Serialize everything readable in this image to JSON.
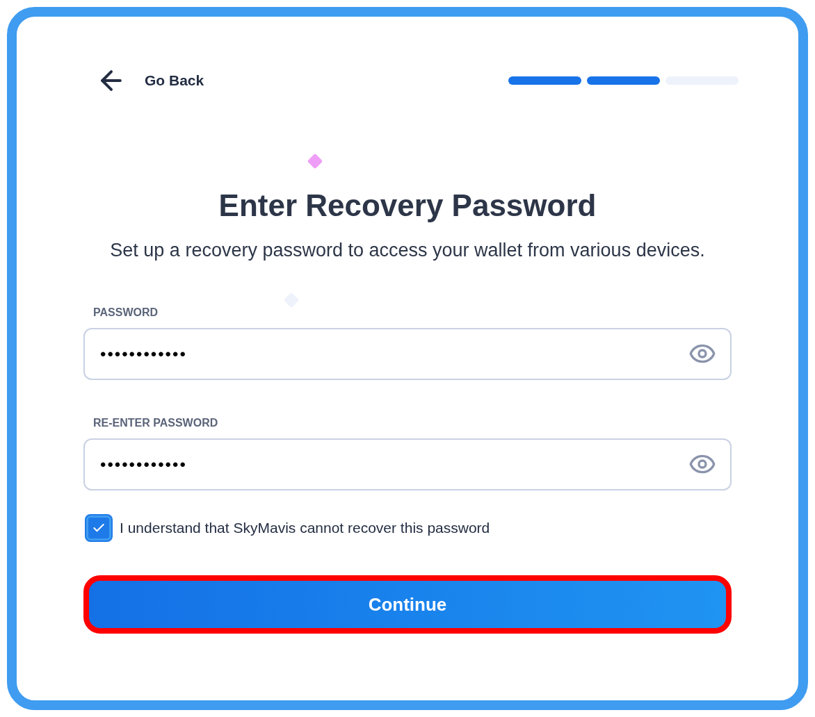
{
  "back_link": {
    "label": "Go Back"
  },
  "progress": [
    {
      "done": true
    },
    {
      "done": true
    },
    {
      "done": false
    }
  ],
  "title": "Enter Recovery Password",
  "subtitle": "Set up a recovery password to access your wallet from various devices.",
  "fields": [
    {
      "label": "PASSWORD",
      "value": "••••••••••••"
    },
    {
      "label": "RE-ENTER PASSWORD",
      "value": "••••••••••••"
    }
  ],
  "consent": {
    "label": "I understand that SkyMavis cannot recover this password",
    "checked": true
  },
  "continue_button": {
    "label": "Continue",
    "highlighted": true
  }
}
